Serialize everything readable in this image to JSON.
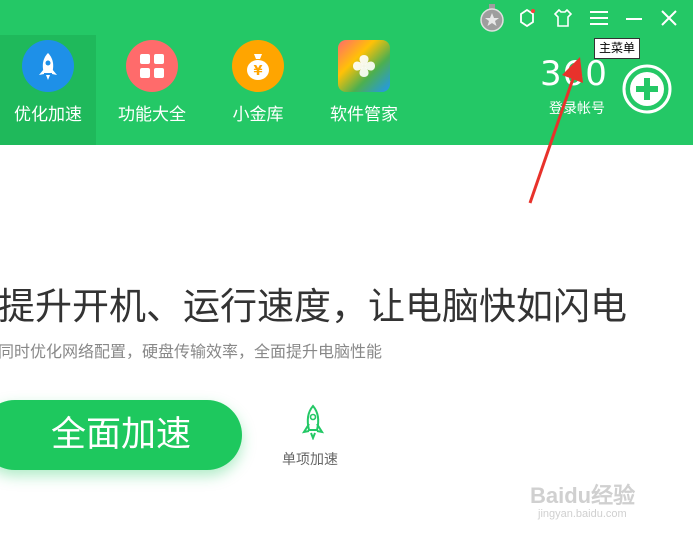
{
  "nav": {
    "items": [
      {
        "label": "优化加速",
        "icon": "rocket-icon",
        "color": "#1e90e8"
      },
      {
        "label": "功能大全",
        "icon": "grid-icon",
        "color": "#ff6b6b"
      },
      {
        "label": "小金库",
        "icon": "money-bag-icon",
        "color": "#ffa500"
      },
      {
        "label": "软件管家",
        "icon": "software-manager-icon",
        "color": "#8bc34a"
      }
    ]
  },
  "account": {
    "logo": "360",
    "login_label": "登录帐号"
  },
  "tooltip": "主菜单",
  "main": {
    "headline": "提升开机、运行速度，让电脑快如闪电",
    "subline": "同时优化网络配置，硬盘传输效率，全面提升电脑性能",
    "accelerate_button": "全面加速",
    "single_accelerate": "单项加速"
  },
  "watermark": {
    "text": "Baidu经验",
    "url": "jingyan.baidu.com"
  },
  "colors": {
    "header": "#24c866",
    "accent": "#1ec85e",
    "arrow": "#e8322b"
  }
}
